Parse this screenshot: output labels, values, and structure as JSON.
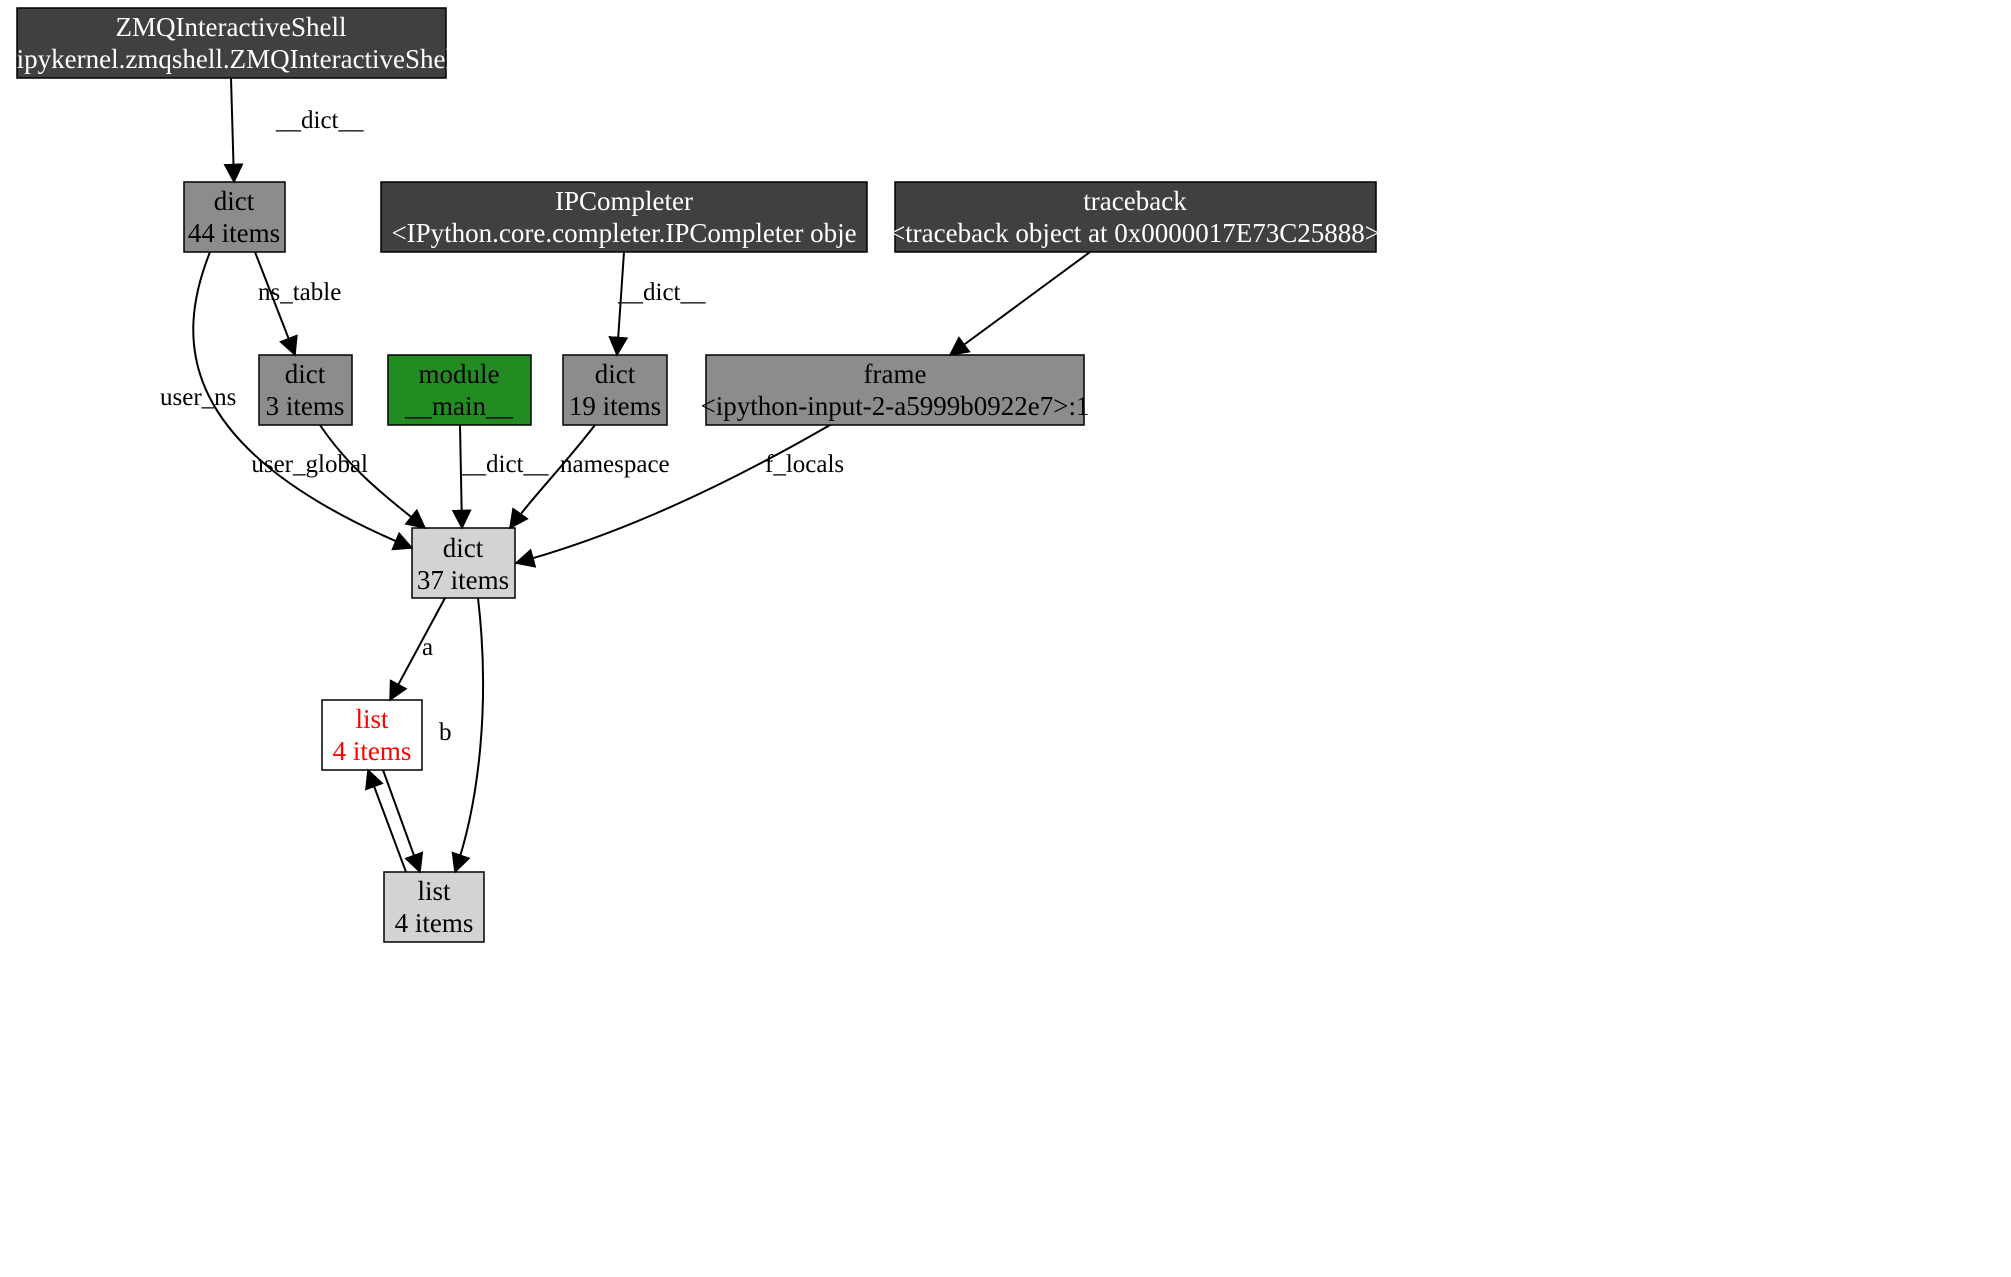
{
  "nodes": {
    "zmq": {
      "line1": "ZMQInteractiveShell",
      "line2": "<ipykernel.zmqshell.ZMQInteractiveShell"
    },
    "dict44": {
      "line1": "dict",
      "line2": "44 items"
    },
    "ipcompleter": {
      "line1": "IPCompleter",
      "line2": "<IPython.core.completer.IPCompleter obje"
    },
    "traceback": {
      "line1": "traceback",
      "line2": "<traceback object at 0x0000017E73C25888>"
    },
    "dict3": {
      "line1": "dict",
      "line2": "3 items"
    },
    "module": {
      "line1": "module",
      "line2": "__main__"
    },
    "dict19": {
      "line1": "dict",
      "line2": "19 items"
    },
    "frame": {
      "line1": "frame",
      "line2": "<ipython-input-2-a5999b0922e7>:1"
    },
    "dict37": {
      "line1": "dict",
      "line2": "37 items"
    },
    "list4a": {
      "line1": "list",
      "line2": "4 items"
    },
    "list4b": {
      "line1": "list",
      "line2": "4 items"
    }
  },
  "edges": {
    "e1": "__dict__",
    "e2": "ns_table",
    "e3": "user_ns",
    "e4": "__dict__",
    "e5": "user_global",
    "e6": "__dict__",
    "e7": "namespace",
    "e8": "f_locals",
    "e9": "a",
    "e10": "b"
  }
}
